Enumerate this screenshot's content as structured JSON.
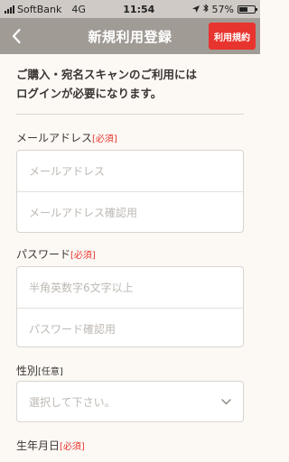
{
  "status": {
    "carrier": "SoftBank",
    "network": "4G",
    "time": "11:54",
    "battery": "57%",
    "battery_level": 0.57
  },
  "nav": {
    "title": "新規利用登録",
    "terms_button": "利用規約"
  },
  "notice": {
    "line1": "ご購入・宛名スキャンのご利用には",
    "line2": "ログインが必要になります。"
  },
  "form": {
    "email": {
      "label": "メールアドレス",
      "badge": "[必須]",
      "placeholder": "メールアドレス",
      "confirm_placeholder": "メールアドレス確認用"
    },
    "password": {
      "label": "パスワード",
      "badge": "[必須]",
      "placeholder": "半角英数字6文字以上",
      "confirm_placeholder": "パスワード確認用"
    },
    "gender": {
      "label": "性別",
      "badge": "[任意]",
      "placeholder": "選択して下さい。"
    },
    "birthday": {
      "label": "生年月日",
      "badge": "[必須]"
    }
  }
}
